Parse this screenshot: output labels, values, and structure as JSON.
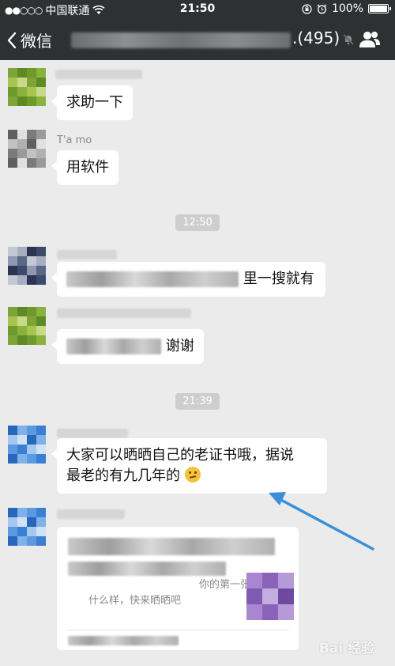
{
  "status_bar": {
    "signal_dots": "●●○○○",
    "carrier": "中国联通",
    "time": "21:50",
    "battery": "100%"
  },
  "nav": {
    "back_label": "微信",
    "member_count": ".(495)"
  },
  "messages": [
    {
      "text": "求助一下"
    },
    {
      "nickname": "T'a mo",
      "text": "用软件"
    },
    {
      "text_visible": "里一搜就有"
    },
    {
      "text_visible": "谢谢"
    },
    {
      "text_line1": "大家可以晒晒自己的老证书哦，据说",
      "text_line2": "最老的有九几年的"
    }
  ],
  "timestamps": [
    "12:50",
    "21:39"
  ],
  "shared_card": {
    "desc_line1": "你的第一张证",
    "desc_line2": "什么样，快来晒晒吧"
  },
  "watermark": "Bai 经验",
  "colors": {
    "header_bg": "#2e3132",
    "chat_bg": "#ebebeb",
    "bubble_bg": "#ffffff",
    "arrow": "#3b8fd8"
  },
  "icons": [
    "chevron-left-icon",
    "wifi-icon",
    "lock-rotation-icon",
    "alarm-icon",
    "battery-icon",
    "mute-icon",
    "group-members-icon"
  ]
}
